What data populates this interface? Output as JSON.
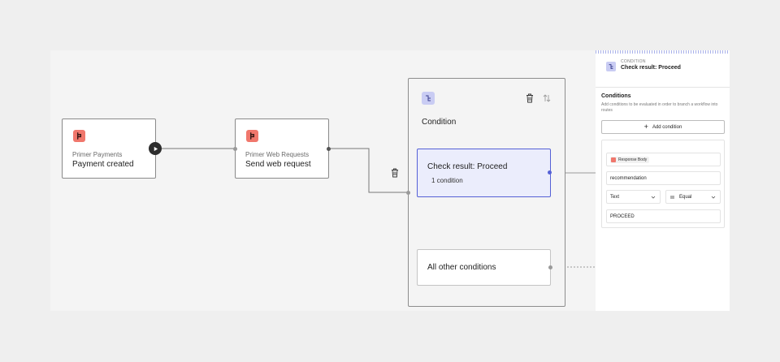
{
  "canvas": {
    "nodes": [
      {
        "subtitle": "Primer Payments",
        "title": "Payment created"
      },
      {
        "subtitle": "Primer Web Requests",
        "title": "Send web request"
      }
    ],
    "condition": {
      "title": "Condition",
      "routes": [
        {
          "title": "Check result: Proceed",
          "subtitle": "1 condition"
        },
        {
          "title": "All other conditions"
        }
      ]
    }
  },
  "panel": {
    "kicker": "CONDITION",
    "title": "Check result: Proceed",
    "section_title": "Conditions",
    "section_description": "Add conditions to be evaluated in order to branch a workflow into routes",
    "add_button_label": "Add condition",
    "condition": {
      "source_chip": "Response Body",
      "path_value": "recommendation",
      "type_value": "Text",
      "operator_value": "Equal",
      "compare_value": "PROCEED"
    }
  },
  "colors": {
    "accent": "#5561d6",
    "primer_orange": "#f0776c",
    "condition_lilac": "#c9ccf3"
  },
  "icons": [
    "primer-logo-icon",
    "play-icon",
    "trash-icon",
    "swap-vertical-icon",
    "condition-branch-icon",
    "plus-icon",
    "equals-icon",
    "chevron-down-icon"
  ]
}
